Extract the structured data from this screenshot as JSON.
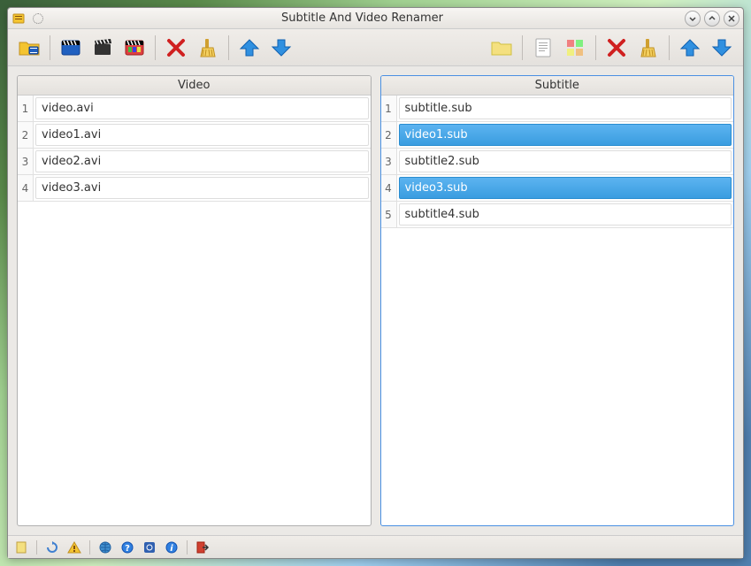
{
  "window": {
    "title": "Subtitle And Video Renamer"
  },
  "panels": {
    "left": {
      "header": "Video",
      "active": false,
      "rows": [
        {
          "num": "1",
          "val": "video.avi",
          "selected": false
        },
        {
          "num": "2",
          "val": "video1.avi",
          "selected": false
        },
        {
          "num": "3",
          "val": "video2.avi",
          "selected": false
        },
        {
          "num": "4",
          "val": "video3.avi",
          "selected": false
        }
      ]
    },
    "right": {
      "header": "Subtitle",
      "active": true,
      "rows": [
        {
          "num": "1",
          "val": "subtitle.sub",
          "selected": false
        },
        {
          "num": "2",
          "val": "video1.sub",
          "selected": true
        },
        {
          "num": "3",
          "val": "subtitle2.sub",
          "selected": false
        },
        {
          "num": "4",
          "val": "video3.sub",
          "selected": true
        },
        {
          "num": "5",
          "val": "subtitle4.sub",
          "selected": false
        }
      ]
    }
  }
}
